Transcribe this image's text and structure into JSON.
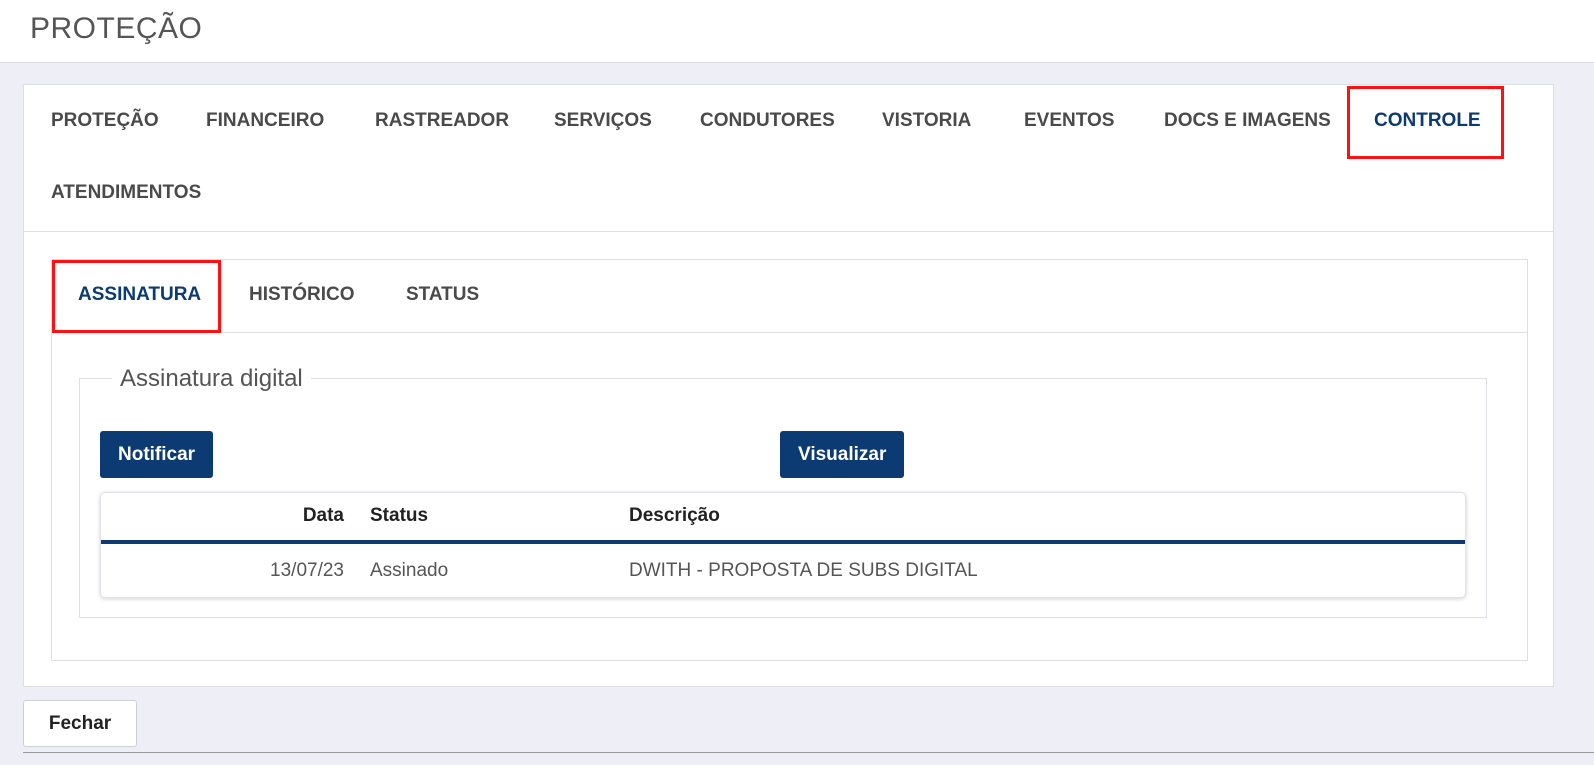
{
  "page": {
    "title": "PROTEÇÃO"
  },
  "main_tabs": [
    {
      "label": "PROTEÇÃO",
      "active": false
    },
    {
      "label": "FINANCEIRO",
      "active": false
    },
    {
      "label": "RASTREADOR",
      "active": false
    },
    {
      "label": "SERVIÇOS",
      "active": false
    },
    {
      "label": "CONDUTORES",
      "active": false
    },
    {
      "label": "VISTORIA",
      "active": false
    },
    {
      "label": "EVENTOS",
      "active": false
    },
    {
      "label": "DOCS E IMAGENS",
      "active": false
    },
    {
      "label": "CONTROLE",
      "active": true
    },
    {
      "label": "ATENDIMENTOS",
      "active": false
    }
  ],
  "sub_tabs": [
    {
      "label": "ASSINATURA",
      "active": true
    },
    {
      "label": "HISTÓRICO",
      "active": false
    },
    {
      "label": "STATUS",
      "active": false
    }
  ],
  "signature_section": {
    "legend": "Assinatura digital",
    "notify_label": "Notificar",
    "view_label": "Visualizar",
    "columns": [
      "Data",
      "Status",
      "Descrição"
    ],
    "rows": [
      {
        "date": "13/07/23",
        "status": "Assinado",
        "description": "DWITH - PROPOSTA DE SUBS DIGITAL"
      }
    ]
  },
  "footer": {
    "close_label": "Fechar"
  },
  "colors": {
    "accent": "#0c3a72",
    "highlight": "#ff1111",
    "background": "#eeeef6"
  }
}
